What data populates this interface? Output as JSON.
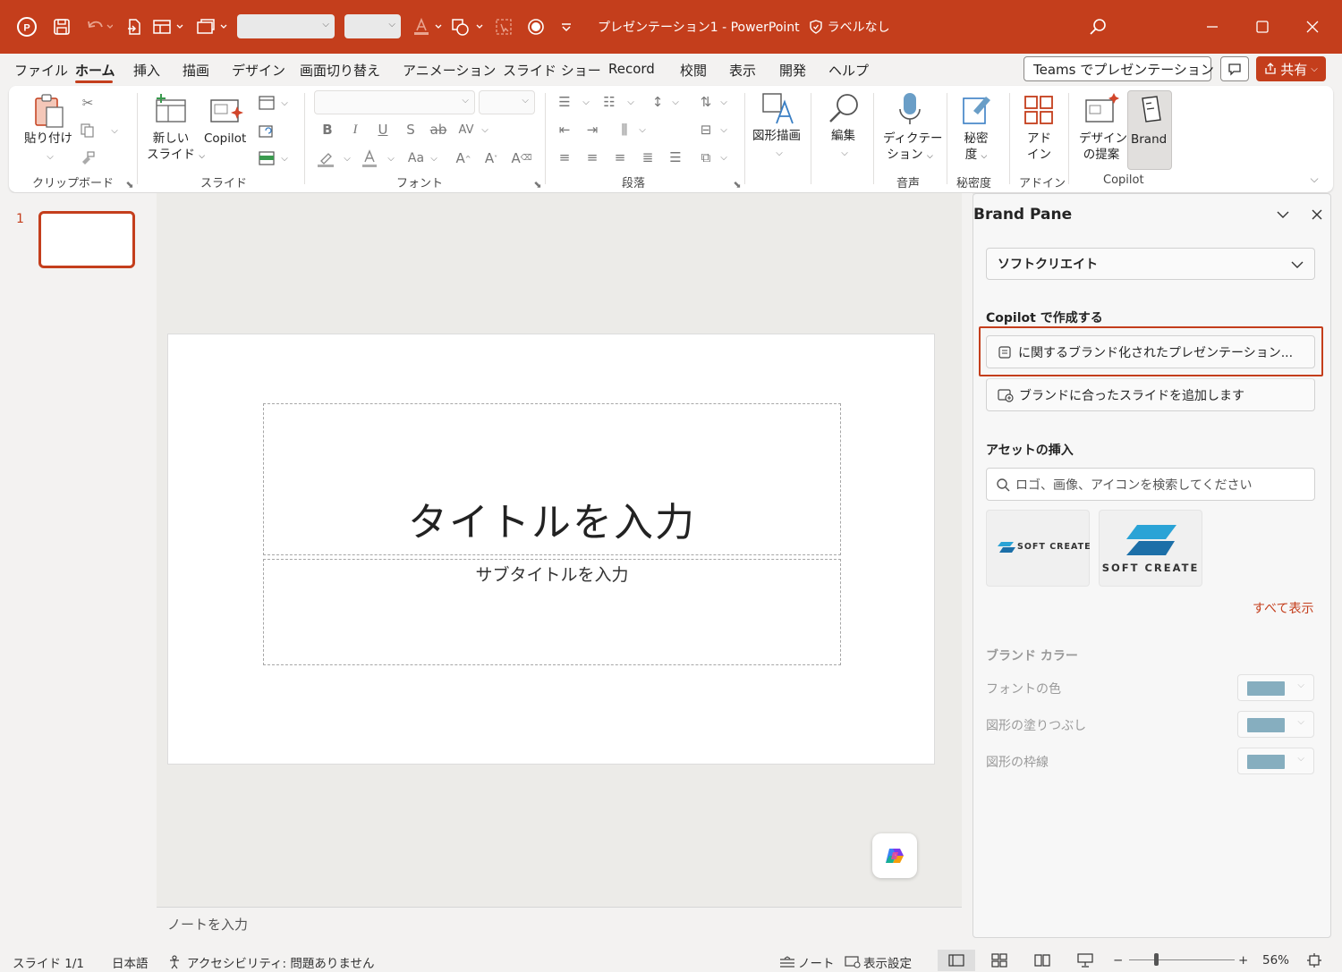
{
  "window": {
    "doc_title": "プレゼンテーション1  -  PowerPoint",
    "label_status": "ラベルなし"
  },
  "menu": {
    "tabs": [
      "ファイル",
      "ホーム",
      "挿入",
      "描画",
      "デザイン",
      "画面切り替え",
      "アニメーション",
      "スライド ショー",
      "Record",
      "校閲",
      "表示",
      "開発",
      "ヘルプ"
    ],
    "teams_button": "Teams でプレゼンテーション",
    "share_button": "共有"
  },
  "ribbon": {
    "paste": "貼り付け",
    "new_slide_1": "新しい",
    "new_slide_2": "スライド",
    "copilot_btn": "Copilot",
    "shape_draw": "図形描画",
    "edit": "編集",
    "dictate_1": "ディクテー",
    "dictate_2": "ション",
    "sensitivity_1": "秘密",
    "sensitivity_2": "度",
    "addin_1": "アド",
    "addin_2": "イン",
    "design_1": "デザイン",
    "design_2": "の提案",
    "brand": "Brand",
    "group_labels": {
      "clipboard": "クリップボード",
      "slide": "スライド",
      "font": "フォント",
      "paragraph": "段落",
      "voice": "音声",
      "sensitivity": "秘密度",
      "addin": "アドイン",
      "copilot": "Copilot"
    }
  },
  "thumbnails": {
    "slide_number": "1"
  },
  "slide": {
    "title_placeholder": "タイトルを入力",
    "subtitle_placeholder": "サブタイトルを入力"
  },
  "notes": {
    "placeholder": "ノートを入力"
  },
  "pane": {
    "title": "Brand Pane",
    "brand_select": "ソフトクリエイト",
    "copilot_heading": "Copilot で作成する",
    "create_presentation": "に関するブランド化されたプレゼンテーション...",
    "add_slide": "ブランドに合ったスライドを追加します",
    "assets_heading": "アセットの挿入",
    "search_placeholder": "ロゴ、画像、アイコンを検索してください",
    "logo_small_text": "SOFT CREATE",
    "logo_large_text": "SOFT CREATE",
    "show_all": "すべて表示",
    "colors_heading": "ブランド カラー",
    "font_color": "フォントの色",
    "shape_fill": "図形の塗りつぶし",
    "shape_outline": "図形の枠線",
    "swatch_color": "#86aebf",
    "accent_color": "#c43e1c"
  },
  "status": {
    "slide_count": "スライド 1/1",
    "language": "日本語",
    "accessibility": "アクセシビリティ: 問題ありません",
    "notes": "ノート",
    "display_settings": "表示設定",
    "zoom": "56%"
  }
}
